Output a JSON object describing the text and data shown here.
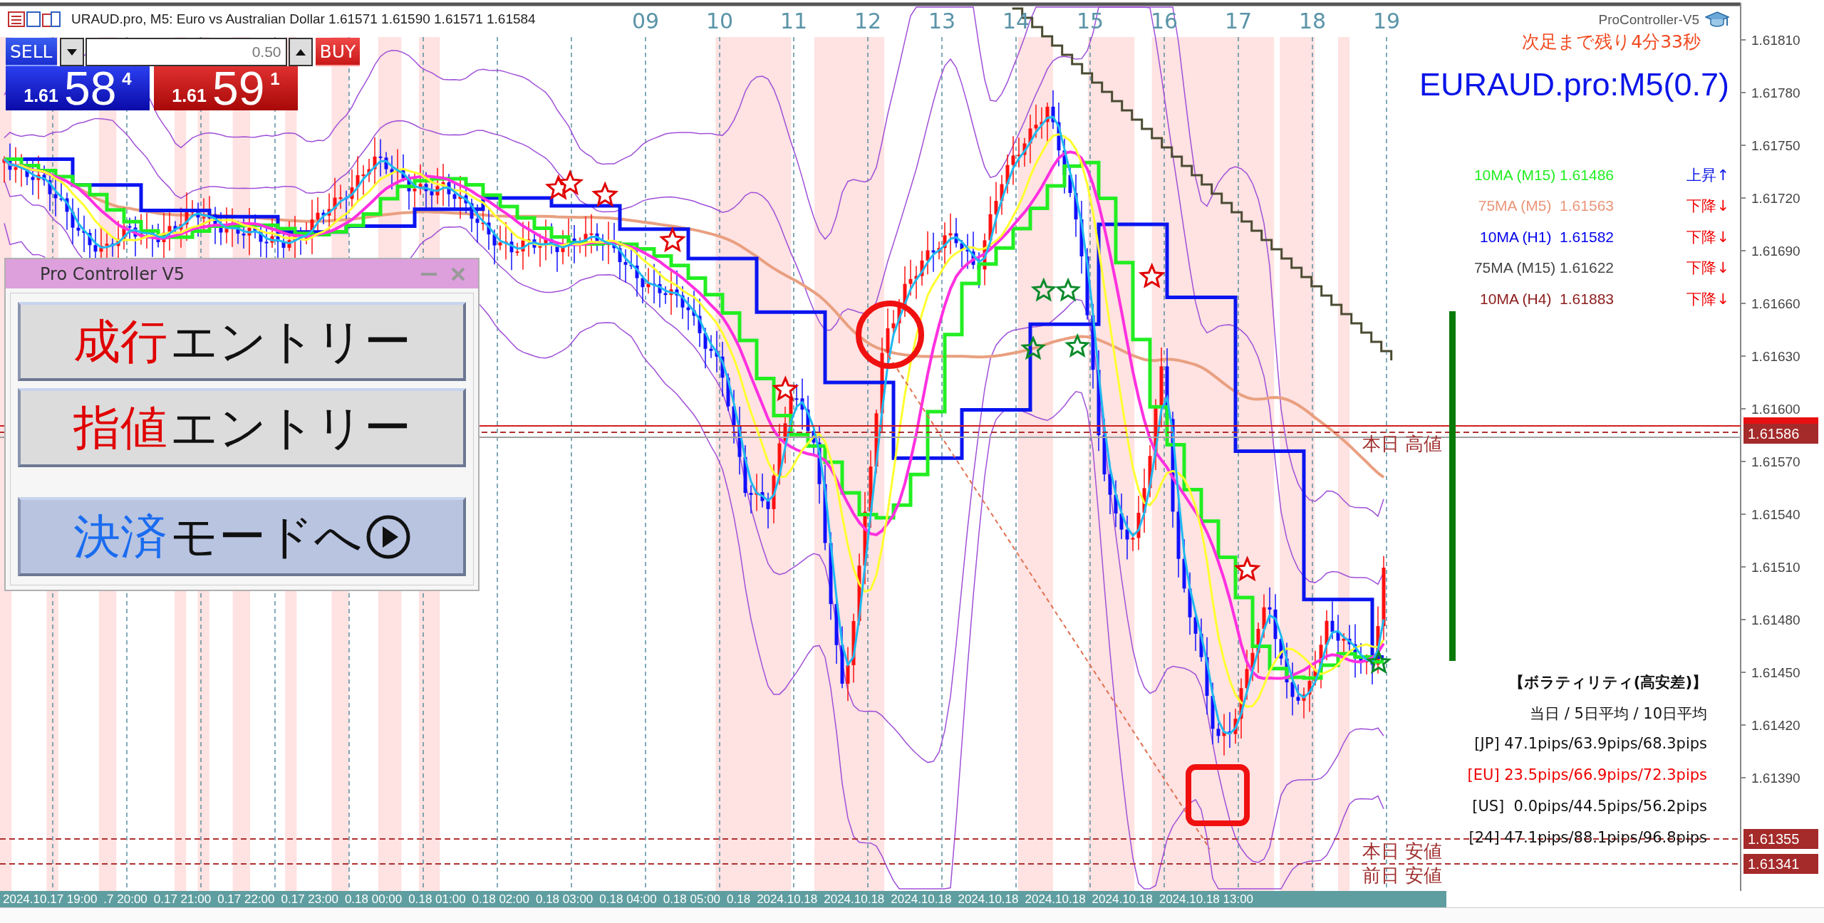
{
  "chart_header": {
    "text": "URAUD.pro, M5: Euro vs Australian Dollar  1.61571 1.61590 1.61571 1.61584"
  },
  "hour_labels": [
    "09",
    "10",
    "11",
    "12",
    "13",
    "14",
    "15",
    "16",
    "17",
    "18",
    "19"
  ],
  "one_click_trading": {
    "sell": {
      "label": "SELL",
      "price_prefix": "1.61",
      "price_main": "58",
      "price_suffix": "4"
    },
    "lot": {
      "value": "0.50"
    },
    "buy": {
      "label": "BUY",
      "price_prefix": "1.61",
      "price_main": "59",
      "price_suffix": "1"
    }
  },
  "indicator": {
    "name": "ProController-V5",
    "countdown": "次足まで残り4分33秒",
    "symbol": "EURAUD.pro:M5(0.7)"
  },
  "ma_rows": [
    {
      "label": "10MA (M15) 1.61486",
      "color": "#22ee22",
      "trend": {
        "text": "上昇↑",
        "color": "#0a14e8"
      }
    },
    {
      "label": "75MA (M5)  1.61563",
      "color": "#e9967a",
      "trend": {
        "text": "下降↓",
        "color": "#f00000"
      }
    },
    {
      "label": "10MA (H1)  1.61582",
      "color": "#0000ee",
      "trend": {
        "text": "下降↓",
        "color": "#f00000"
      }
    },
    {
      "label": "75MA (M15) 1.61622",
      "color": "#444444",
      "trend": {
        "text": "下降↓",
        "color": "#f00000"
      }
    },
    {
      "label": "10MA (H4)  1.61883",
      "color": "#8b1a1a",
      "trend": {
        "text": "下降↓",
        "color": "#f00000"
      }
    }
  ],
  "controller_panel": {
    "title": "Pro Controller V5",
    "buttons": [
      {
        "kind": "entry",
        "accent": "成行",
        "label": "エントリー"
      },
      {
        "kind": "entry",
        "accent": "指値",
        "label": "エントリー"
      },
      {
        "kind": "mode",
        "accent": "決済",
        "label": "モードへ"
      }
    ]
  },
  "chart_labels": [
    "本日 高値",
    "本日 安値",
    "前日 安値"
  ],
  "volatility": {
    "title": "【ボラティリティ(高安差)】",
    "header": "当日 / 5日平均 / 10日平均",
    "rows": [
      {
        "text": "[JP] 47.1pips/63.9pips/68.3pips",
        "active": false
      },
      {
        "text": "[EU] 23.5pips/66.9pips/72.3pips",
        "active": true
      },
      {
        "text": "[US]  0.0pips/44.5pips/56.2pips",
        "active": false
      },
      {
        "text": "[24] 47.1pips/88.1pips/96.8pips",
        "active": false
      }
    ]
  },
  "price_axis": {
    "ticks": [
      "1.61810",
      "1.61780",
      "1.61750",
      "1.61720",
      "1.61690",
      "1.61660",
      "1.61630",
      "1.61600",
      "1.61570",
      "1.61540",
      "1.61510",
      "1.61480",
      "1.61450",
      "1.61420",
      "1.61390"
    ],
    "badges": [
      "1.61586",
      "1.61355",
      "1.61341"
    ]
  },
  "time_axis": [
    "2024.10.17 19:00",
    ".7 20:00",
    "0.17 21:00",
    "0.17 22:00",
    "0.17 23:00",
    "0.18 00:00",
    "0.18 01:00",
    "0.18 02:00",
    "0.18 03:00",
    "0.18 04:00",
    "0.18 05:00",
    "0.18",
    "2024.10.18",
    "2024.10.18",
    "2024.10.18",
    "2024.10.18",
    "2024.10.18",
    "2024.10.18",
    "2024.10.18 13:00"
  ]
}
